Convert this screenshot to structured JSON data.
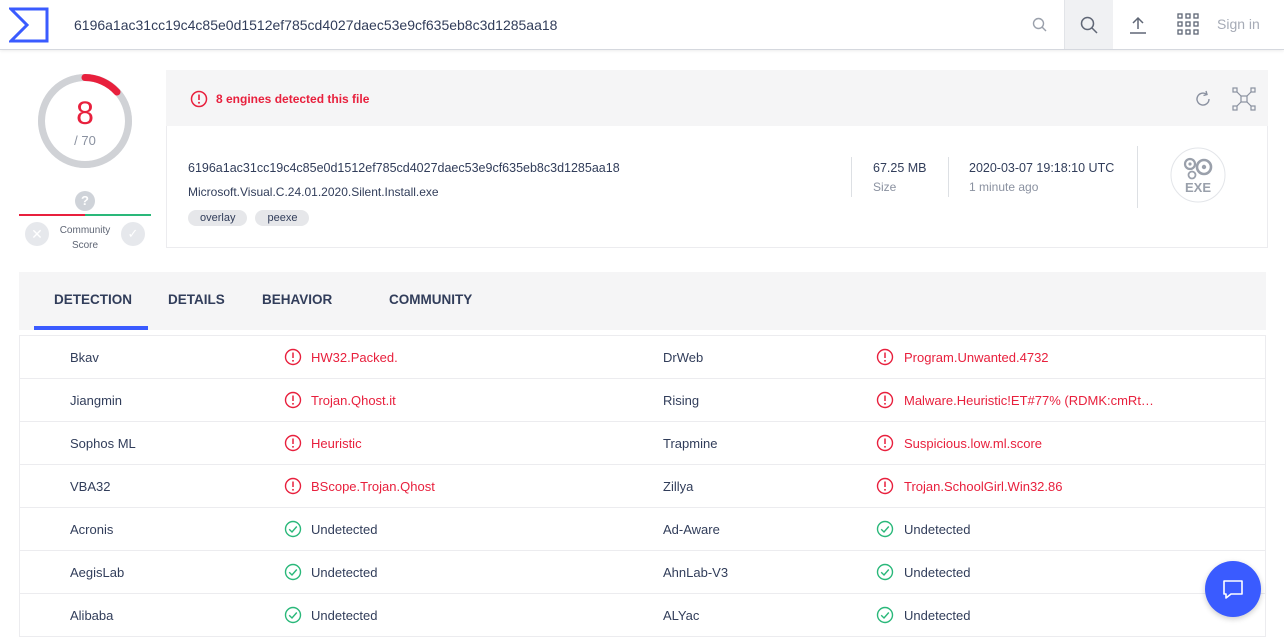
{
  "search": {
    "value": "6196a1ac31cc19c4c85e0d1512ef785cd4027daec53e9cf635eb8c3d1285aa18"
  },
  "header": {
    "signin_label": "Sign in"
  },
  "score": {
    "detected": "8",
    "total": "/ 70"
  },
  "community": {
    "label": "Community Score",
    "question": "?"
  },
  "summary": {
    "alert": "8 engines detected this file",
    "hash": "6196a1ac31cc19c4c85e0d1512ef785cd4027daec53e9cf635eb8c3d1285aa18",
    "filename": "Microsoft.Visual.C.24.01.2020.Silent.Install.exe",
    "tags": [
      "overlay",
      "peexe"
    ],
    "size_value": "67.25 MB",
    "size_label": "Size",
    "date_value": "2020-03-07 19:18:10 UTC",
    "date_relative": "1 minute ago",
    "file_type": "EXE"
  },
  "tabs": [
    "DETECTION",
    "DETAILS",
    "BEHAVIOR",
    "COMMUNITY"
  ],
  "detections": [
    {
      "left_engine": "Bkav",
      "left_result": "HW32.Packed.",
      "left_status": "malicious",
      "right_engine": "DrWeb",
      "right_result": "Program.Unwanted.4732",
      "right_status": "malicious"
    },
    {
      "left_engine": "Jiangmin",
      "left_result": "Trojan.Qhost.it",
      "left_status": "malicious",
      "right_engine": "Rising",
      "right_result": "Malware.Heuristic!ET#77% (RDMK:cmRt…",
      "right_status": "malicious"
    },
    {
      "left_engine": "Sophos ML",
      "left_result": "Heuristic",
      "left_status": "malicious",
      "right_engine": "Trapmine",
      "right_result": "Suspicious.low.ml.score",
      "right_status": "malicious"
    },
    {
      "left_engine": "VBA32",
      "left_result": "BScope.Trojan.Qhost",
      "left_status": "malicious",
      "right_engine": "Zillya",
      "right_result": "Trojan.SchoolGirl.Win32.86",
      "right_status": "malicious"
    },
    {
      "left_engine": "Acronis",
      "left_result": "Undetected",
      "left_status": "clean",
      "right_engine": "Ad-Aware",
      "right_result": "Undetected",
      "right_status": "clean"
    },
    {
      "left_engine": "AegisLab",
      "left_result": "Undetected",
      "left_status": "clean",
      "right_engine": "AhnLab-V3",
      "right_result": "Undetected",
      "right_status": "clean"
    },
    {
      "left_engine": "Alibaba",
      "left_result": "Undetected",
      "left_status": "clean",
      "right_engine": "ALYac",
      "right_result": "Undetected",
      "right_status": "clean"
    }
  ],
  "colors": {
    "accent": "#3a5bff",
    "malicious": "#e8203d",
    "clean": "#2ab87a"
  }
}
